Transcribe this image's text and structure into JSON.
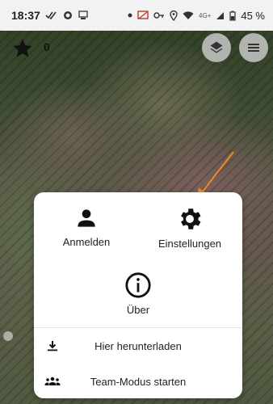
{
  "status_bar": {
    "time": "18:37",
    "network": "4G+",
    "battery": "45 %"
  },
  "map": {
    "star_count": "0"
  },
  "menu": {
    "tiles": [
      {
        "label": "Anmelden",
        "icon": "person-icon"
      },
      {
        "label": "Einstellungen",
        "icon": "gear-icon"
      },
      {
        "label": "Über",
        "icon": "info-icon"
      }
    ],
    "rows": [
      {
        "label": "Hier herunterladen",
        "icon": "download-icon"
      },
      {
        "label": "Team-Modus starten",
        "icon": "group-icon"
      }
    ]
  },
  "colors": {
    "annotation_arrow": "#f08a24",
    "sheet_bg": "#ffffff"
  }
}
